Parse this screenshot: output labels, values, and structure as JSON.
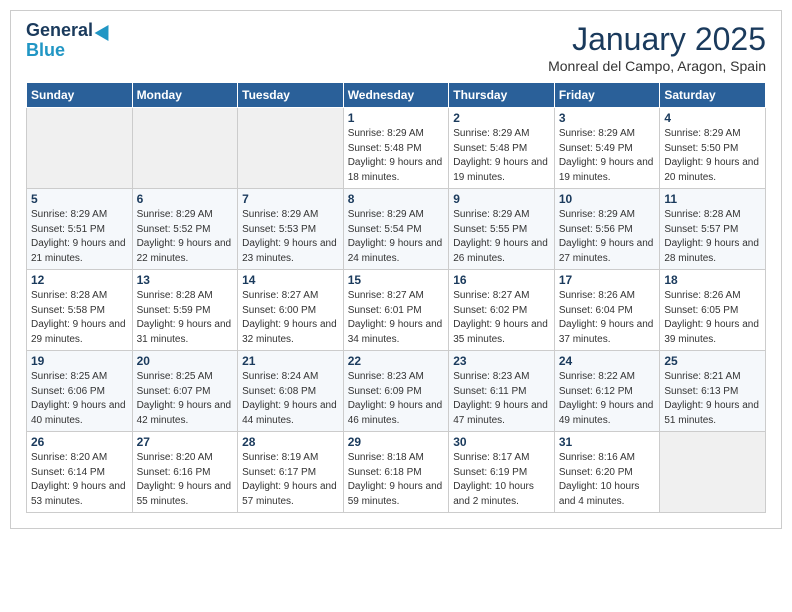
{
  "logo": {
    "general": "General",
    "blue": "Blue"
  },
  "header": {
    "title": "January 2025",
    "location": "Monreal del Campo, Aragon, Spain"
  },
  "weekdays": [
    "Sunday",
    "Monday",
    "Tuesday",
    "Wednesday",
    "Thursday",
    "Friday",
    "Saturday"
  ],
  "weeks": [
    [
      {
        "day": "",
        "sunrise": "",
        "sunset": "",
        "daylight": ""
      },
      {
        "day": "",
        "sunrise": "",
        "sunset": "",
        "daylight": ""
      },
      {
        "day": "",
        "sunrise": "",
        "sunset": "",
        "daylight": ""
      },
      {
        "day": "1",
        "sunrise": "Sunrise: 8:29 AM",
        "sunset": "Sunset: 5:48 PM",
        "daylight": "Daylight: 9 hours and 18 minutes."
      },
      {
        "day": "2",
        "sunrise": "Sunrise: 8:29 AM",
        "sunset": "Sunset: 5:48 PM",
        "daylight": "Daylight: 9 hours and 19 minutes."
      },
      {
        "day": "3",
        "sunrise": "Sunrise: 8:29 AM",
        "sunset": "Sunset: 5:49 PM",
        "daylight": "Daylight: 9 hours and 19 minutes."
      },
      {
        "day": "4",
        "sunrise": "Sunrise: 8:29 AM",
        "sunset": "Sunset: 5:50 PM",
        "daylight": "Daylight: 9 hours and 20 minutes."
      }
    ],
    [
      {
        "day": "5",
        "sunrise": "Sunrise: 8:29 AM",
        "sunset": "Sunset: 5:51 PM",
        "daylight": "Daylight: 9 hours and 21 minutes."
      },
      {
        "day": "6",
        "sunrise": "Sunrise: 8:29 AM",
        "sunset": "Sunset: 5:52 PM",
        "daylight": "Daylight: 9 hours and 22 minutes."
      },
      {
        "day": "7",
        "sunrise": "Sunrise: 8:29 AM",
        "sunset": "Sunset: 5:53 PM",
        "daylight": "Daylight: 9 hours and 23 minutes."
      },
      {
        "day": "8",
        "sunrise": "Sunrise: 8:29 AM",
        "sunset": "Sunset: 5:54 PM",
        "daylight": "Daylight: 9 hours and 24 minutes."
      },
      {
        "day": "9",
        "sunrise": "Sunrise: 8:29 AM",
        "sunset": "Sunset: 5:55 PM",
        "daylight": "Daylight: 9 hours and 26 minutes."
      },
      {
        "day": "10",
        "sunrise": "Sunrise: 8:29 AM",
        "sunset": "Sunset: 5:56 PM",
        "daylight": "Daylight: 9 hours and 27 minutes."
      },
      {
        "day": "11",
        "sunrise": "Sunrise: 8:28 AM",
        "sunset": "Sunset: 5:57 PM",
        "daylight": "Daylight: 9 hours and 28 minutes."
      }
    ],
    [
      {
        "day": "12",
        "sunrise": "Sunrise: 8:28 AM",
        "sunset": "Sunset: 5:58 PM",
        "daylight": "Daylight: 9 hours and 29 minutes."
      },
      {
        "day": "13",
        "sunrise": "Sunrise: 8:28 AM",
        "sunset": "Sunset: 5:59 PM",
        "daylight": "Daylight: 9 hours and 31 minutes."
      },
      {
        "day": "14",
        "sunrise": "Sunrise: 8:27 AM",
        "sunset": "Sunset: 6:00 PM",
        "daylight": "Daylight: 9 hours and 32 minutes."
      },
      {
        "day": "15",
        "sunrise": "Sunrise: 8:27 AM",
        "sunset": "Sunset: 6:01 PM",
        "daylight": "Daylight: 9 hours and 34 minutes."
      },
      {
        "day": "16",
        "sunrise": "Sunrise: 8:27 AM",
        "sunset": "Sunset: 6:02 PM",
        "daylight": "Daylight: 9 hours and 35 minutes."
      },
      {
        "day": "17",
        "sunrise": "Sunrise: 8:26 AM",
        "sunset": "Sunset: 6:04 PM",
        "daylight": "Daylight: 9 hours and 37 minutes."
      },
      {
        "day": "18",
        "sunrise": "Sunrise: 8:26 AM",
        "sunset": "Sunset: 6:05 PM",
        "daylight": "Daylight: 9 hours and 39 minutes."
      }
    ],
    [
      {
        "day": "19",
        "sunrise": "Sunrise: 8:25 AM",
        "sunset": "Sunset: 6:06 PM",
        "daylight": "Daylight: 9 hours and 40 minutes."
      },
      {
        "day": "20",
        "sunrise": "Sunrise: 8:25 AM",
        "sunset": "Sunset: 6:07 PM",
        "daylight": "Daylight: 9 hours and 42 minutes."
      },
      {
        "day": "21",
        "sunrise": "Sunrise: 8:24 AM",
        "sunset": "Sunset: 6:08 PM",
        "daylight": "Daylight: 9 hours and 44 minutes."
      },
      {
        "day": "22",
        "sunrise": "Sunrise: 8:23 AM",
        "sunset": "Sunset: 6:09 PM",
        "daylight": "Daylight: 9 hours and 46 minutes."
      },
      {
        "day": "23",
        "sunrise": "Sunrise: 8:23 AM",
        "sunset": "Sunset: 6:11 PM",
        "daylight": "Daylight: 9 hours and 47 minutes."
      },
      {
        "day": "24",
        "sunrise": "Sunrise: 8:22 AM",
        "sunset": "Sunset: 6:12 PM",
        "daylight": "Daylight: 9 hours and 49 minutes."
      },
      {
        "day": "25",
        "sunrise": "Sunrise: 8:21 AM",
        "sunset": "Sunset: 6:13 PM",
        "daylight": "Daylight: 9 hours and 51 minutes."
      }
    ],
    [
      {
        "day": "26",
        "sunrise": "Sunrise: 8:20 AM",
        "sunset": "Sunset: 6:14 PM",
        "daylight": "Daylight: 9 hours and 53 minutes."
      },
      {
        "day": "27",
        "sunrise": "Sunrise: 8:20 AM",
        "sunset": "Sunset: 6:16 PM",
        "daylight": "Daylight: 9 hours and 55 minutes."
      },
      {
        "day": "28",
        "sunrise": "Sunrise: 8:19 AM",
        "sunset": "Sunset: 6:17 PM",
        "daylight": "Daylight: 9 hours and 57 minutes."
      },
      {
        "day": "29",
        "sunrise": "Sunrise: 8:18 AM",
        "sunset": "Sunset: 6:18 PM",
        "daylight": "Daylight: 9 hours and 59 minutes."
      },
      {
        "day": "30",
        "sunrise": "Sunrise: 8:17 AM",
        "sunset": "Sunset: 6:19 PM",
        "daylight": "Daylight: 10 hours and 2 minutes."
      },
      {
        "day": "31",
        "sunrise": "Sunrise: 8:16 AM",
        "sunset": "Sunset: 6:20 PM",
        "daylight": "Daylight: 10 hours and 4 minutes."
      },
      {
        "day": "",
        "sunrise": "",
        "sunset": "",
        "daylight": ""
      }
    ]
  ]
}
